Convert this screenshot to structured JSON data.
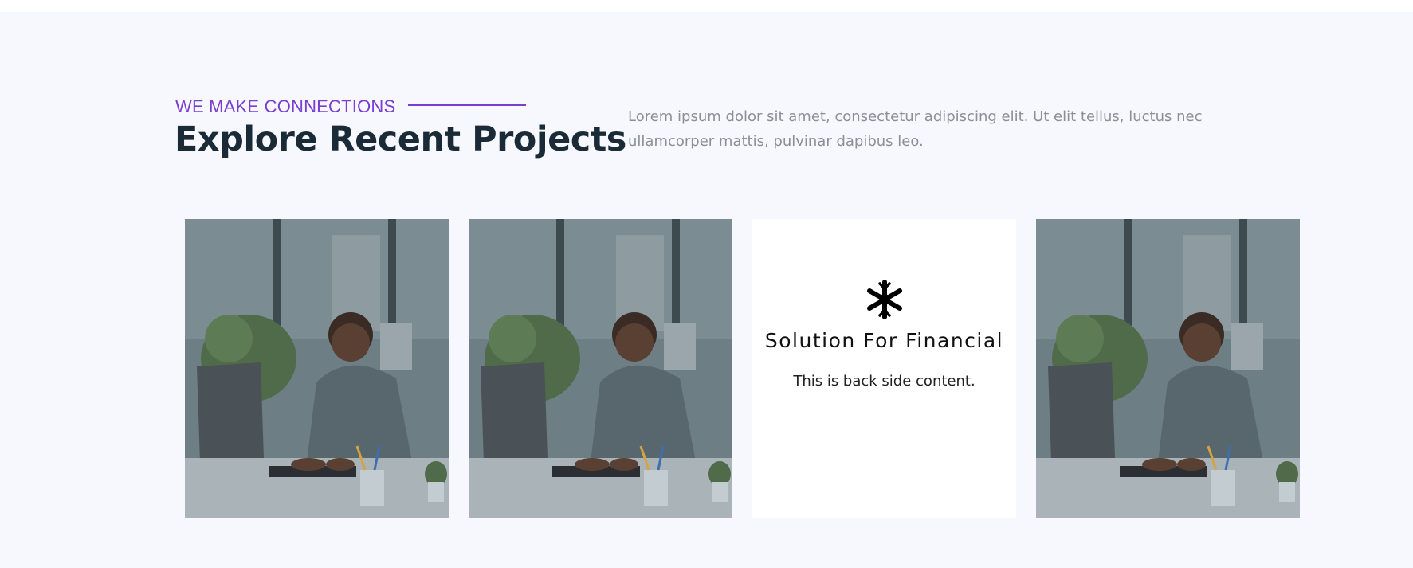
{
  "header": {
    "eyebrow": "WE MAKE CONNECTIONS",
    "title": "Explore Recent Projects",
    "intro": "Lorem ipsum dolor sit amet, consectetur adipiscing elit. Ut elit tellus, luctus nec ullamcorper mattis, pulvinar dapibus leo."
  },
  "cards": [
    {
      "type": "image",
      "icon": "photo-man-at-laptop"
    },
    {
      "type": "image",
      "icon": "photo-man-at-laptop"
    },
    {
      "type": "content",
      "icon": "snowflake-icon",
      "title": "Solution For Financial",
      "text": "This is back side content."
    },
    {
      "type": "image",
      "icon": "photo-man-at-laptop"
    }
  ],
  "colors": {
    "accent": "#7a3fd1",
    "heading": "#1a2b37",
    "section_bg": "#f7f8fd",
    "body_text": "#8a8f98"
  }
}
